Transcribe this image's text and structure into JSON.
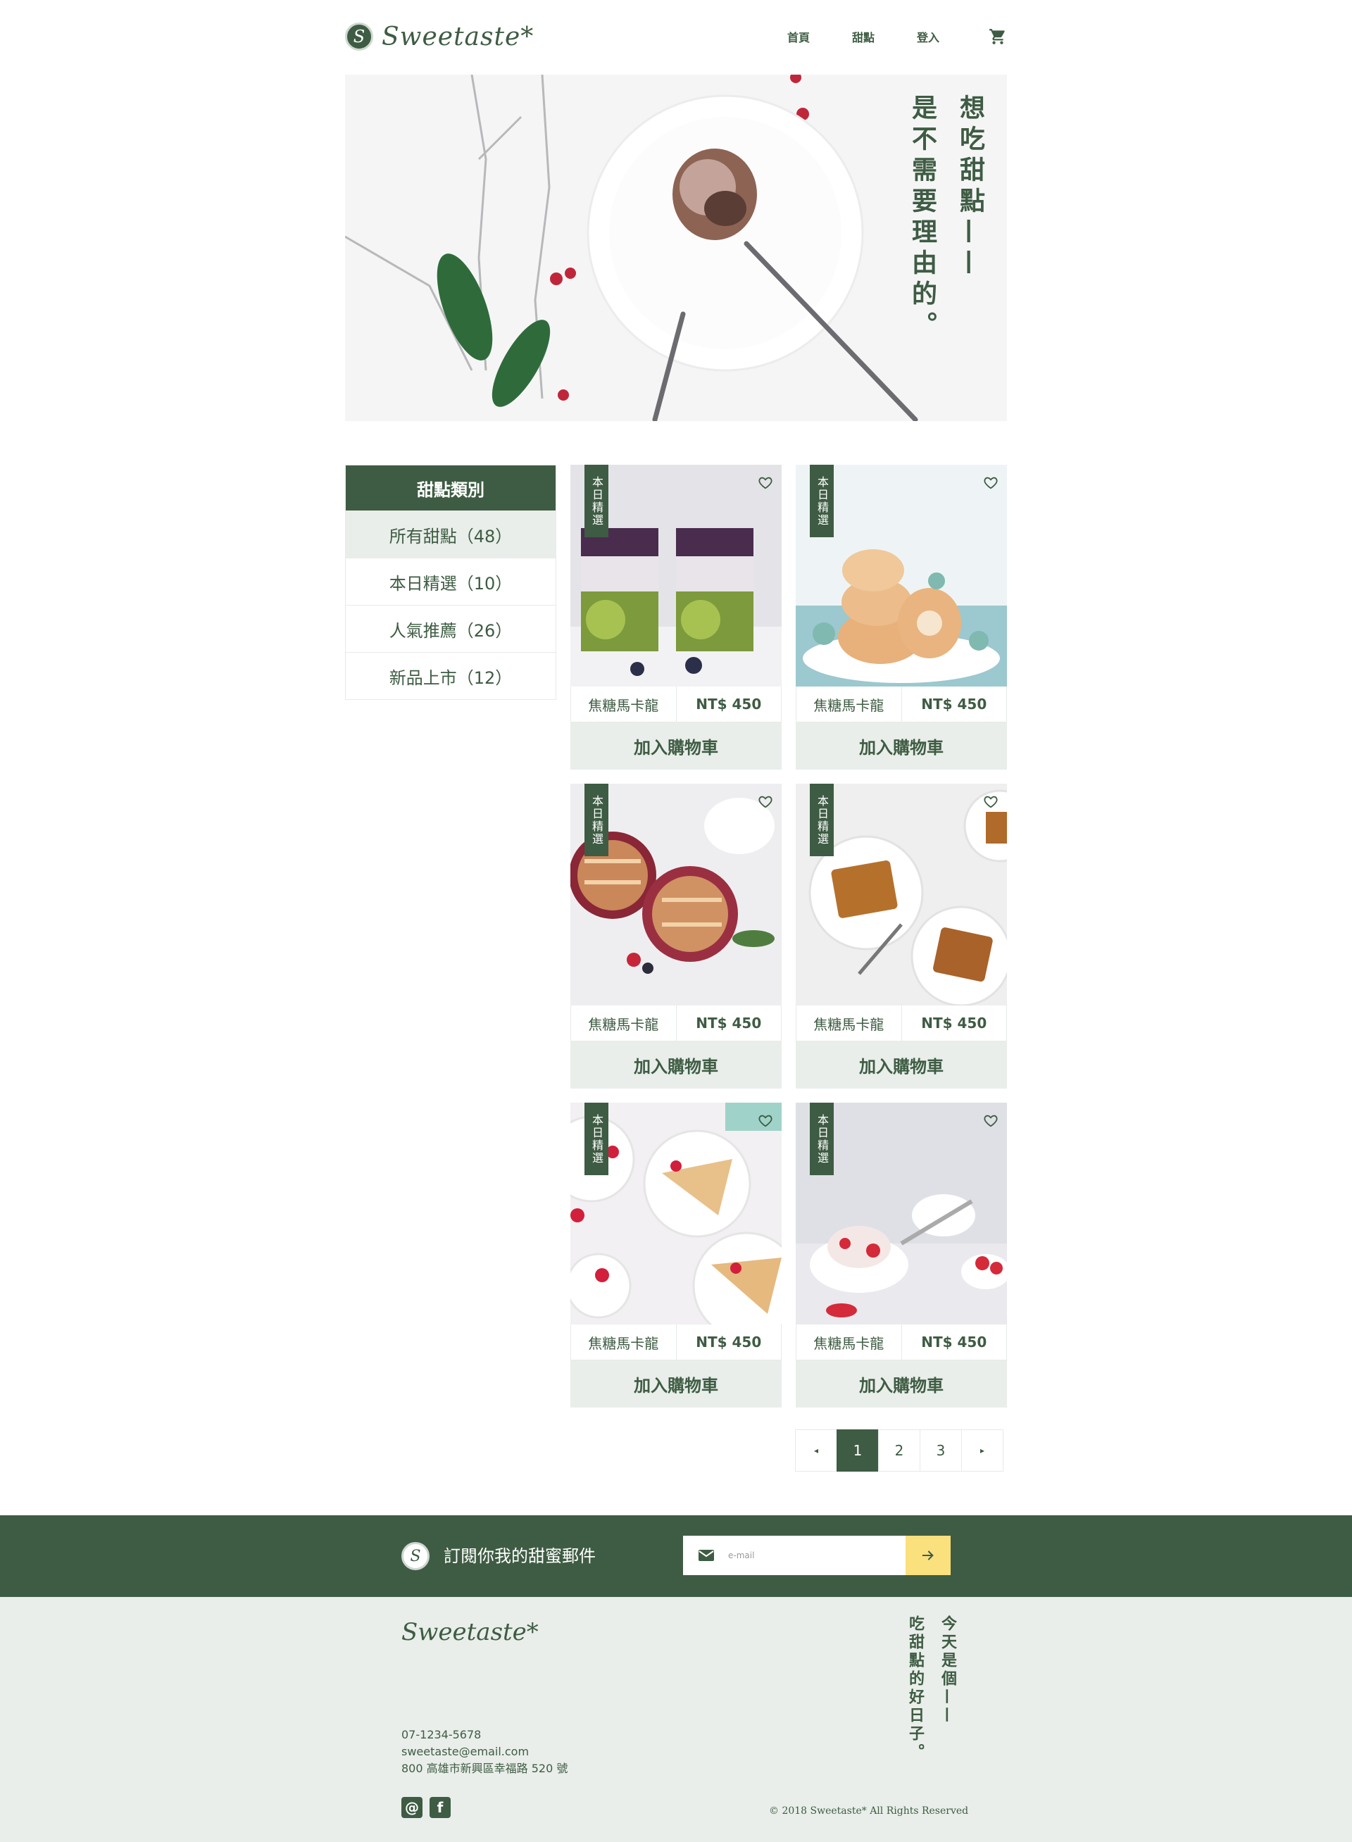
{
  "brand": {
    "logo_mark": "S",
    "name": "Sweetaste*"
  },
  "nav": {
    "items": [
      "首頁",
      "甜點",
      "登入"
    ]
  },
  "hero": {
    "lines": [
      "想吃甜點——",
      "是不需要理由的。"
    ]
  },
  "sidebar": {
    "title": "甜點類別",
    "items": [
      {
        "label": "所有甜點（48）"
      },
      {
        "label": "本日精選（10）"
      },
      {
        "label": "人氣推薦（26）"
      },
      {
        "label": "新品上市（12）"
      }
    ]
  },
  "products": [
    {
      "badge": "本日精選",
      "name": "焦糖馬卡龍",
      "price": "NT$ 450",
      "button": "加入購物車"
    },
    {
      "badge": "本日精選",
      "name": "焦糖馬卡龍",
      "price": "NT$ 450",
      "button": "加入購物車"
    },
    {
      "badge": "本日精選",
      "name": "焦糖馬卡龍",
      "price": "NT$ 450",
      "button": "加入購物車"
    },
    {
      "badge": "本日精選",
      "name": "焦糖馬卡龍",
      "price": "NT$ 450",
      "button": "加入購物車"
    },
    {
      "badge": "本日精選",
      "name": "焦糖馬卡龍",
      "price": "NT$ 450",
      "button": "加入購物車"
    },
    {
      "badge": "本日精選",
      "name": "焦糖馬卡龍",
      "price": "NT$ 450",
      "button": "加入購物車"
    }
  ],
  "pagination": {
    "prev": "◂",
    "pages": [
      "1",
      "2",
      "3"
    ],
    "next": "▸",
    "current": "1"
  },
  "subscribe": {
    "logo_mark": "S",
    "title": "訂閱你我的甜蜜郵件",
    "placeholder": "e-mail"
  },
  "footer": {
    "logo": "Sweetaste*",
    "phone": "07-1234-5678",
    "email": "sweetaste@email.com",
    "address": "800 高雄市新興區幸福路 520 號",
    "social": [
      "@",
      "f"
    ],
    "slogan": [
      "今天是個——",
      "吃甜點的好日子。"
    ],
    "copyright": "© 2018 Sweetaste* All Rights Reserved"
  },
  "icons": {
    "cart": "cart-icon",
    "heart": "heart-icon",
    "mail": "mail-icon",
    "arrow": "arrow-right-icon",
    "prev": "chevron-left-icon",
    "next": "chevron-right-icon"
  },
  "colors": {
    "primary": "#3e5c43",
    "light": "#e9eeea",
    "accent": "#fbe07e"
  }
}
